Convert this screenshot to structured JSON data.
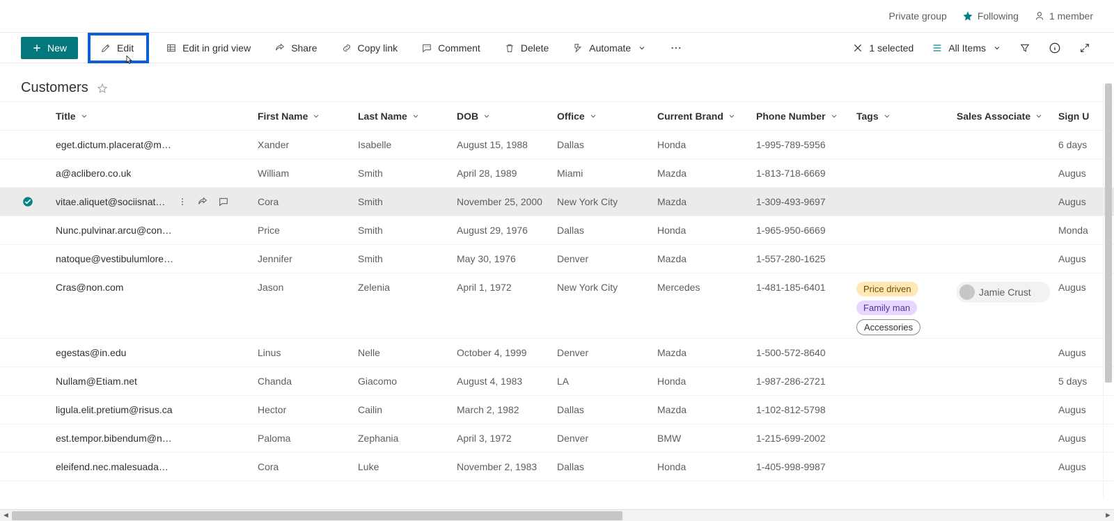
{
  "header": {
    "group_label": "Private group",
    "following_label": "Following",
    "members_label": "1 member"
  },
  "commands": {
    "new": "New",
    "edit": "Edit",
    "edit_grid": "Edit in grid view",
    "share": "Share",
    "copy_link": "Copy link",
    "comment": "Comment",
    "delete": "Delete",
    "automate": "Automate",
    "selected_label": "1 selected",
    "view_label": "All Items"
  },
  "list": {
    "title": "Customers"
  },
  "columns": {
    "title": "Title",
    "first": "First Name",
    "last": "Last Name",
    "dob": "DOB",
    "office": "Office",
    "brand": "Current Brand",
    "phone": "Phone Number",
    "tags": "Tags",
    "assoc": "Sales Associate",
    "signup": "Sign U"
  },
  "rows": [
    {
      "title": "eget.dictum.placerat@mattis.ca",
      "first": "Xander",
      "last": "Isabelle",
      "dob": "August 15, 1988",
      "office": "Dallas",
      "brand": "Honda",
      "phone": "1-995-789-5956",
      "tags": [],
      "assoc": "",
      "signup": "6 days"
    },
    {
      "title": "a@aclibero.co.uk",
      "first": "William",
      "last": "Smith",
      "dob": "April 28, 1989",
      "office": "Miami",
      "brand": "Mazda",
      "phone": "1-813-718-6669",
      "tags": [],
      "assoc": "",
      "signup": "Augus"
    },
    {
      "title": "vitae.aliquet@sociisnato…",
      "selected": true,
      "first": "Cora",
      "last": "Smith",
      "dob": "November 25, 2000",
      "office": "New York City",
      "brand": "Mazda",
      "phone": "1-309-493-9697",
      "tags": [],
      "assoc": "",
      "signup": "Augus"
    },
    {
      "title": "Nunc.pulvinar.arcu@conubianostraper.edu",
      "first": "Price",
      "last": "Smith",
      "dob": "August 29, 1976",
      "office": "Dallas",
      "brand": "Honda",
      "phone": "1-965-950-6669",
      "tags": [],
      "assoc": "",
      "signup": "Monda"
    },
    {
      "title": "natoque@vestibulumlorem.edu",
      "first": "Jennifer",
      "last": "Smith",
      "dob": "May 30, 1976",
      "office": "Denver",
      "brand": "Mazda",
      "phone": "1-557-280-1625",
      "tags": [],
      "assoc": "",
      "signup": "Augus"
    },
    {
      "title": "Cras@non.com",
      "first": "Jason",
      "last": "Zelenia",
      "dob": "April 1, 1972",
      "office": "New York City",
      "brand": "Mercedes",
      "phone": "1-481-185-6401",
      "tags": [
        "Price driven",
        "Family man",
        "Accessories"
      ],
      "assoc": "Jamie Crust",
      "signup": "Augus",
      "tall": true
    },
    {
      "title": "egestas@in.edu",
      "first": "Linus",
      "last": "Nelle",
      "dob": "October 4, 1999",
      "office": "Denver",
      "brand": "Mazda",
      "phone": "1-500-572-8640",
      "tags": [],
      "assoc": "",
      "signup": "Augus"
    },
    {
      "title": "Nullam@Etiam.net",
      "first": "Chanda",
      "last": "Giacomo",
      "dob": "August 4, 1983",
      "office": "LA",
      "brand": "Honda",
      "phone": "1-987-286-2721",
      "tags": [],
      "assoc": "",
      "signup": "5 days"
    },
    {
      "title": "ligula.elit.pretium@risus.ca",
      "first": "Hector",
      "last": "Cailin",
      "dob": "March 2, 1982",
      "office": "Dallas",
      "brand": "Mazda",
      "phone": "1-102-812-5798",
      "tags": [],
      "assoc": "",
      "signup": "Augus"
    },
    {
      "title": "est.tempor.bibendum@neccursusa.com",
      "first": "Paloma",
      "last": "Zephania",
      "dob": "April 3, 1972",
      "office": "Denver",
      "brand": "BMW",
      "phone": "1-215-699-2002",
      "tags": [],
      "assoc": "",
      "signup": "Augus"
    },
    {
      "title": "eleifend.nec.malesuada@atrisus.ca",
      "first": "Cora",
      "last": "Luke",
      "dob": "November 2, 1983",
      "office": "Dallas",
      "brand": "Honda",
      "phone": "1-405-998-9987",
      "tags": [],
      "assoc": "",
      "signup": "Augus"
    }
  ],
  "tag_class": {
    "Price driven": "tag-price",
    "Family man": "tag-family",
    "Accessories": "tag-acc"
  }
}
